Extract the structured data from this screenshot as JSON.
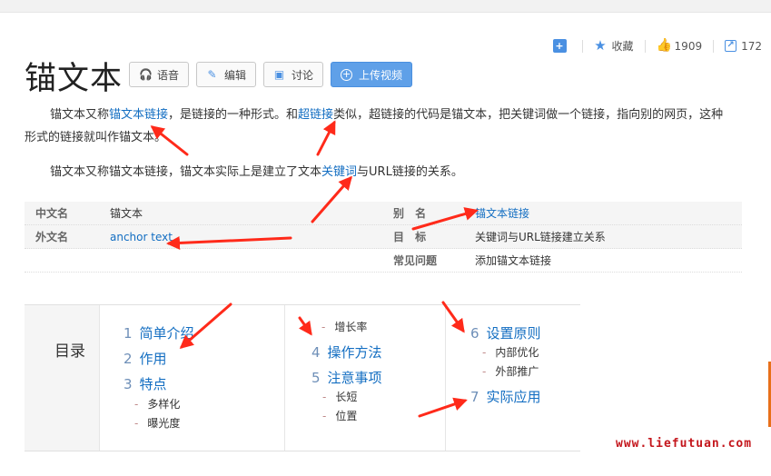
{
  "stats": {
    "add_icon": "plus-icon",
    "favorite_label": "收藏",
    "likes": "1909",
    "shares": "172"
  },
  "title": "锚文本",
  "actions": {
    "voice": "语音",
    "edit": "编辑",
    "discuss": "讨论",
    "upload": "上传视频"
  },
  "summary": {
    "p1_a": "锚文本又称",
    "p1_link1": "锚文本链接",
    "p1_b": "，是链接的一种形式。和",
    "p1_link2": "超链接",
    "p1_c": "类似，超链接的代码是锚文本，把关键词做一个链接，指向别的网页，这种形式的链接就叫作锚文本。",
    "p2_a": "锚文本又称锚文本链接，锚文本实际上是建立了文本",
    "p2_link": "关键词",
    "p2_b": "与URL链接的关系。"
  },
  "info": {
    "chinese_name_label": "中文名",
    "chinese_name": "锚文本",
    "alias_label": "别 名",
    "alias": "锚文本链接",
    "foreign_name_label": "外文名",
    "foreign_name": "anchor text",
    "goal_label": "目 标",
    "goal": "关键词与URL链接建立关系",
    "faq_label": "常见问题",
    "faq": "添加锚文本链接"
  },
  "toc": {
    "label": "目录",
    "items": [
      {
        "num": "1",
        "text": "简单介绍"
      },
      {
        "num": "2",
        "text": "作用"
      },
      {
        "num": "3",
        "text": "特点"
      },
      {
        "num": "4",
        "text": "操作方法"
      },
      {
        "num": "5",
        "text": "注意事项"
      },
      {
        "num": "6",
        "text": "设置原则"
      },
      {
        "num": "7",
        "text": "实际应用"
      }
    ],
    "sub": {
      "s3a": "多样化",
      "s3b": "曝光度",
      "s3c": "增长率",
      "s5a": "长短",
      "s5b": "位置",
      "s6a": "内部优化",
      "s6b": "外部推广"
    }
  },
  "watermark": "www.liefutuan.com",
  "colors": {
    "link": "#136ec2",
    "accent": "#4a90e2",
    "arrow": "#ff2a1a",
    "watermark": "#c4161c"
  }
}
